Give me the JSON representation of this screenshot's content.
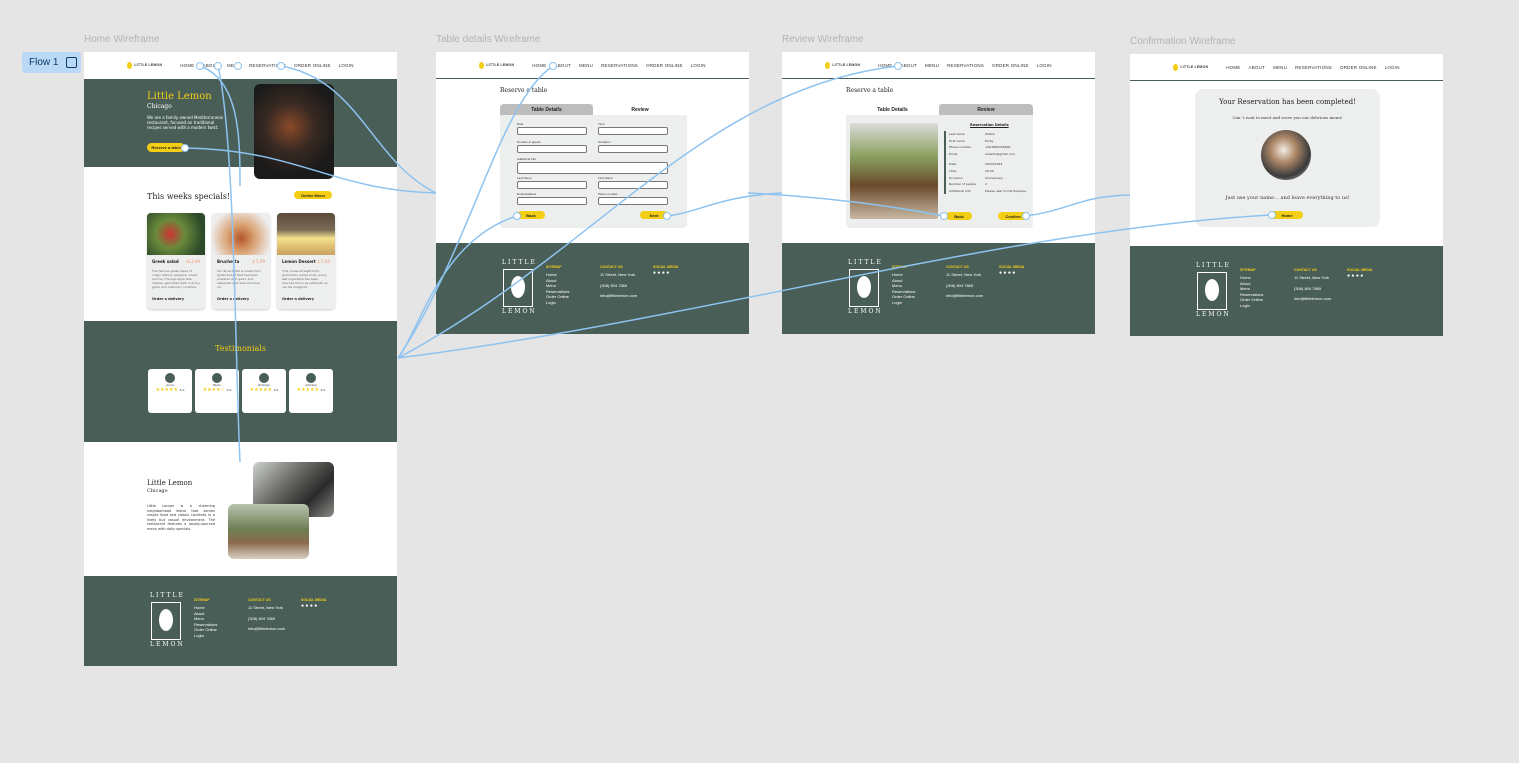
{
  "flow": {
    "label": "Flow 1"
  },
  "frames": {
    "home": "Home Wireframe",
    "table": "Table details Wireframe",
    "review": "Review Wireframe",
    "confirm": "Confirmation Wireframe"
  },
  "nav": {
    "logo": "LITTLE LEMON",
    "items": [
      "HOME",
      "ABOUT",
      "MENU",
      "RESERVATIONS",
      "ORDER ONLINE",
      "LOGIN"
    ]
  },
  "home": {
    "hero_title": "Little Lemon",
    "hero_sub": "Chicago",
    "hero_desc": "We are a family owned Mediterranean restaurant, focused on traditional recipes served with a modern twist.",
    "hero_button": "Reserve a table",
    "specials_title": "This weeks specials!",
    "specials_button": "Online Menu",
    "specials": [
      {
        "name": "Greek salad",
        "price": "$12.99",
        "desc": "The famous greek salad of crispy lettuce, peppers, olives and our Chicago style feta cheese, garnished with crunchy garlic and rosemary croutons.",
        "order": "Order a delivery"
      },
      {
        "name": "Bruchetta",
        "price": "$ 5.99",
        "desc": "Our Bruschetta is made from grilled bread that has been smeared with garlic and seasoned with salt and olive oil.",
        "order": "Order a delivery"
      },
      {
        "name": "Lemon Dessert",
        "price": "$ 5.00",
        "desc": "This comes straight from grandma's recipe book, every last ingredient has been sourced and is as authentic as can be imagined.",
        "order": "Order a delivery"
      }
    ],
    "testimonials_title": "Testimonials",
    "testimonials": [
      {
        "name": "Anna",
        "rating": "5.0"
      },
      {
        "name": "Paolo",
        "rating": "4.0"
      },
      {
        "name": "Rodrigo",
        "rating": "5.0"
      },
      {
        "name": "Adriana",
        "rating": "5.0"
      }
    ],
    "about_title": "Little Lemon",
    "about_sub": "Chicago",
    "about_desc": "Little Lemon is a charming neighborhood bistro that serves simple food and classic cocktails in a lively but casual environment. The restaurant features a locally-sourced menu with daily specials."
  },
  "footer": {
    "logo_top": "LITTLE",
    "logo_bottom": "LEMON",
    "sitemap_head": "SITEMAP",
    "sitemap": [
      "Home",
      "About",
      "Menu",
      "Reservations",
      "Order Online",
      "Login"
    ],
    "contact_head": "CONTACT US",
    "address": "11 Street, New York",
    "phone": "(308) 804 7865",
    "email": "info@littlelemon.com",
    "social_head": "SOCIAL MEDIA"
  },
  "table": {
    "page_title": "Reserve a table",
    "tab_details": "Table Details",
    "tab_review": "Review",
    "fields": [
      "Date",
      "Time",
      "Number of guests",
      "Occasion",
      "Additional Info",
      "Last Name",
      "First Name",
      "Email Address",
      "Phone number"
    ],
    "back": "Back",
    "next": "Next"
  },
  "review": {
    "page_title": "Reserve a table",
    "tab_details": "Table Details",
    "tab_review": "Review",
    "section": "Reservation Details",
    "rows": [
      [
        "Last name",
        "Willow"
      ],
      [
        "First name",
        "Emily"
      ],
      [
        "Phone number",
        "+001860245600"
      ],
      [
        "Email",
        "emwillo@gmail.com"
      ],
      [
        "Date",
        "16/03/2024"
      ],
      [
        "Time",
        "20:00"
      ],
      [
        "Occasion",
        "Anniversary"
      ],
      [
        "Number of people",
        "2"
      ],
      [
        "Additional Info",
        "Please near to the fireplace"
      ]
    ],
    "back": "Back",
    "confirm": "Confirm"
  },
  "confirm": {
    "title": "Your Reservation has been completed!",
    "sub": "Can’ t wait to meet and serve you our delicious menu!",
    "bottom": "Just use your name… and leave everything to us!",
    "home": "Home"
  },
  "colors": {
    "green": "#495e57",
    "yellow": "#f4ce14",
    "connector": "#8dc3f0",
    "canvas": "#e5e5e5"
  }
}
